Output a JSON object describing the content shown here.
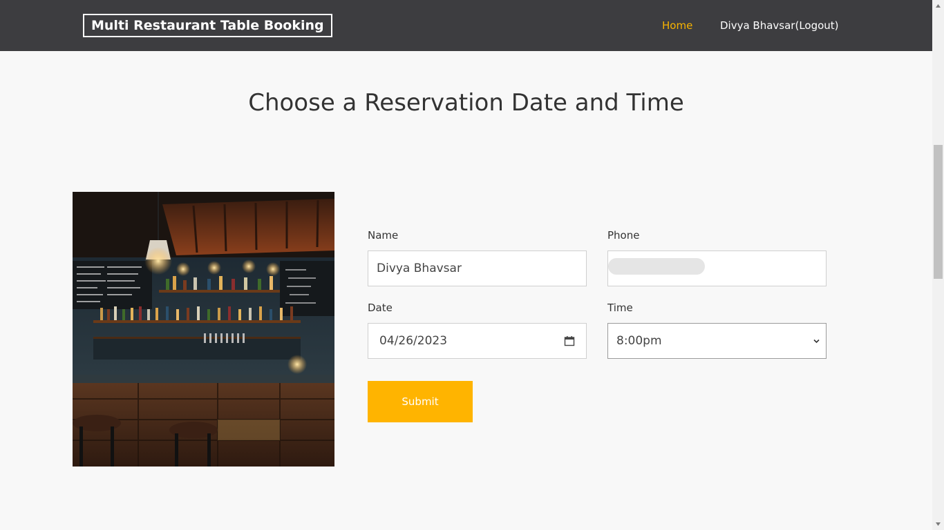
{
  "navbar": {
    "brand": "Multi Restaurant Table Booking",
    "home_link": "Home",
    "user_link": "Divya Bhavsar(Logout)"
  },
  "main": {
    "title": "Choose a Reservation Date and Time"
  },
  "form": {
    "name_label": "Name",
    "name_value": "Divya Bhavsar",
    "phone_label": "Phone",
    "phone_value": "",
    "date_label": "Date",
    "date_month": "04",
    "date_day": "26",
    "date_year": "2023",
    "date_sep": "/",
    "time_label": "Time",
    "time_value": "8:00pm",
    "submit_label": "Submit"
  },
  "colors": {
    "navbar_bg": "#3d3d40",
    "accent": "#ffb400",
    "home_active": "#f8b400",
    "page_bg": "#f8f8f8"
  },
  "icons": {
    "date_picker": "calendar-icon",
    "time_dropdown": "chevron-down-icon"
  }
}
